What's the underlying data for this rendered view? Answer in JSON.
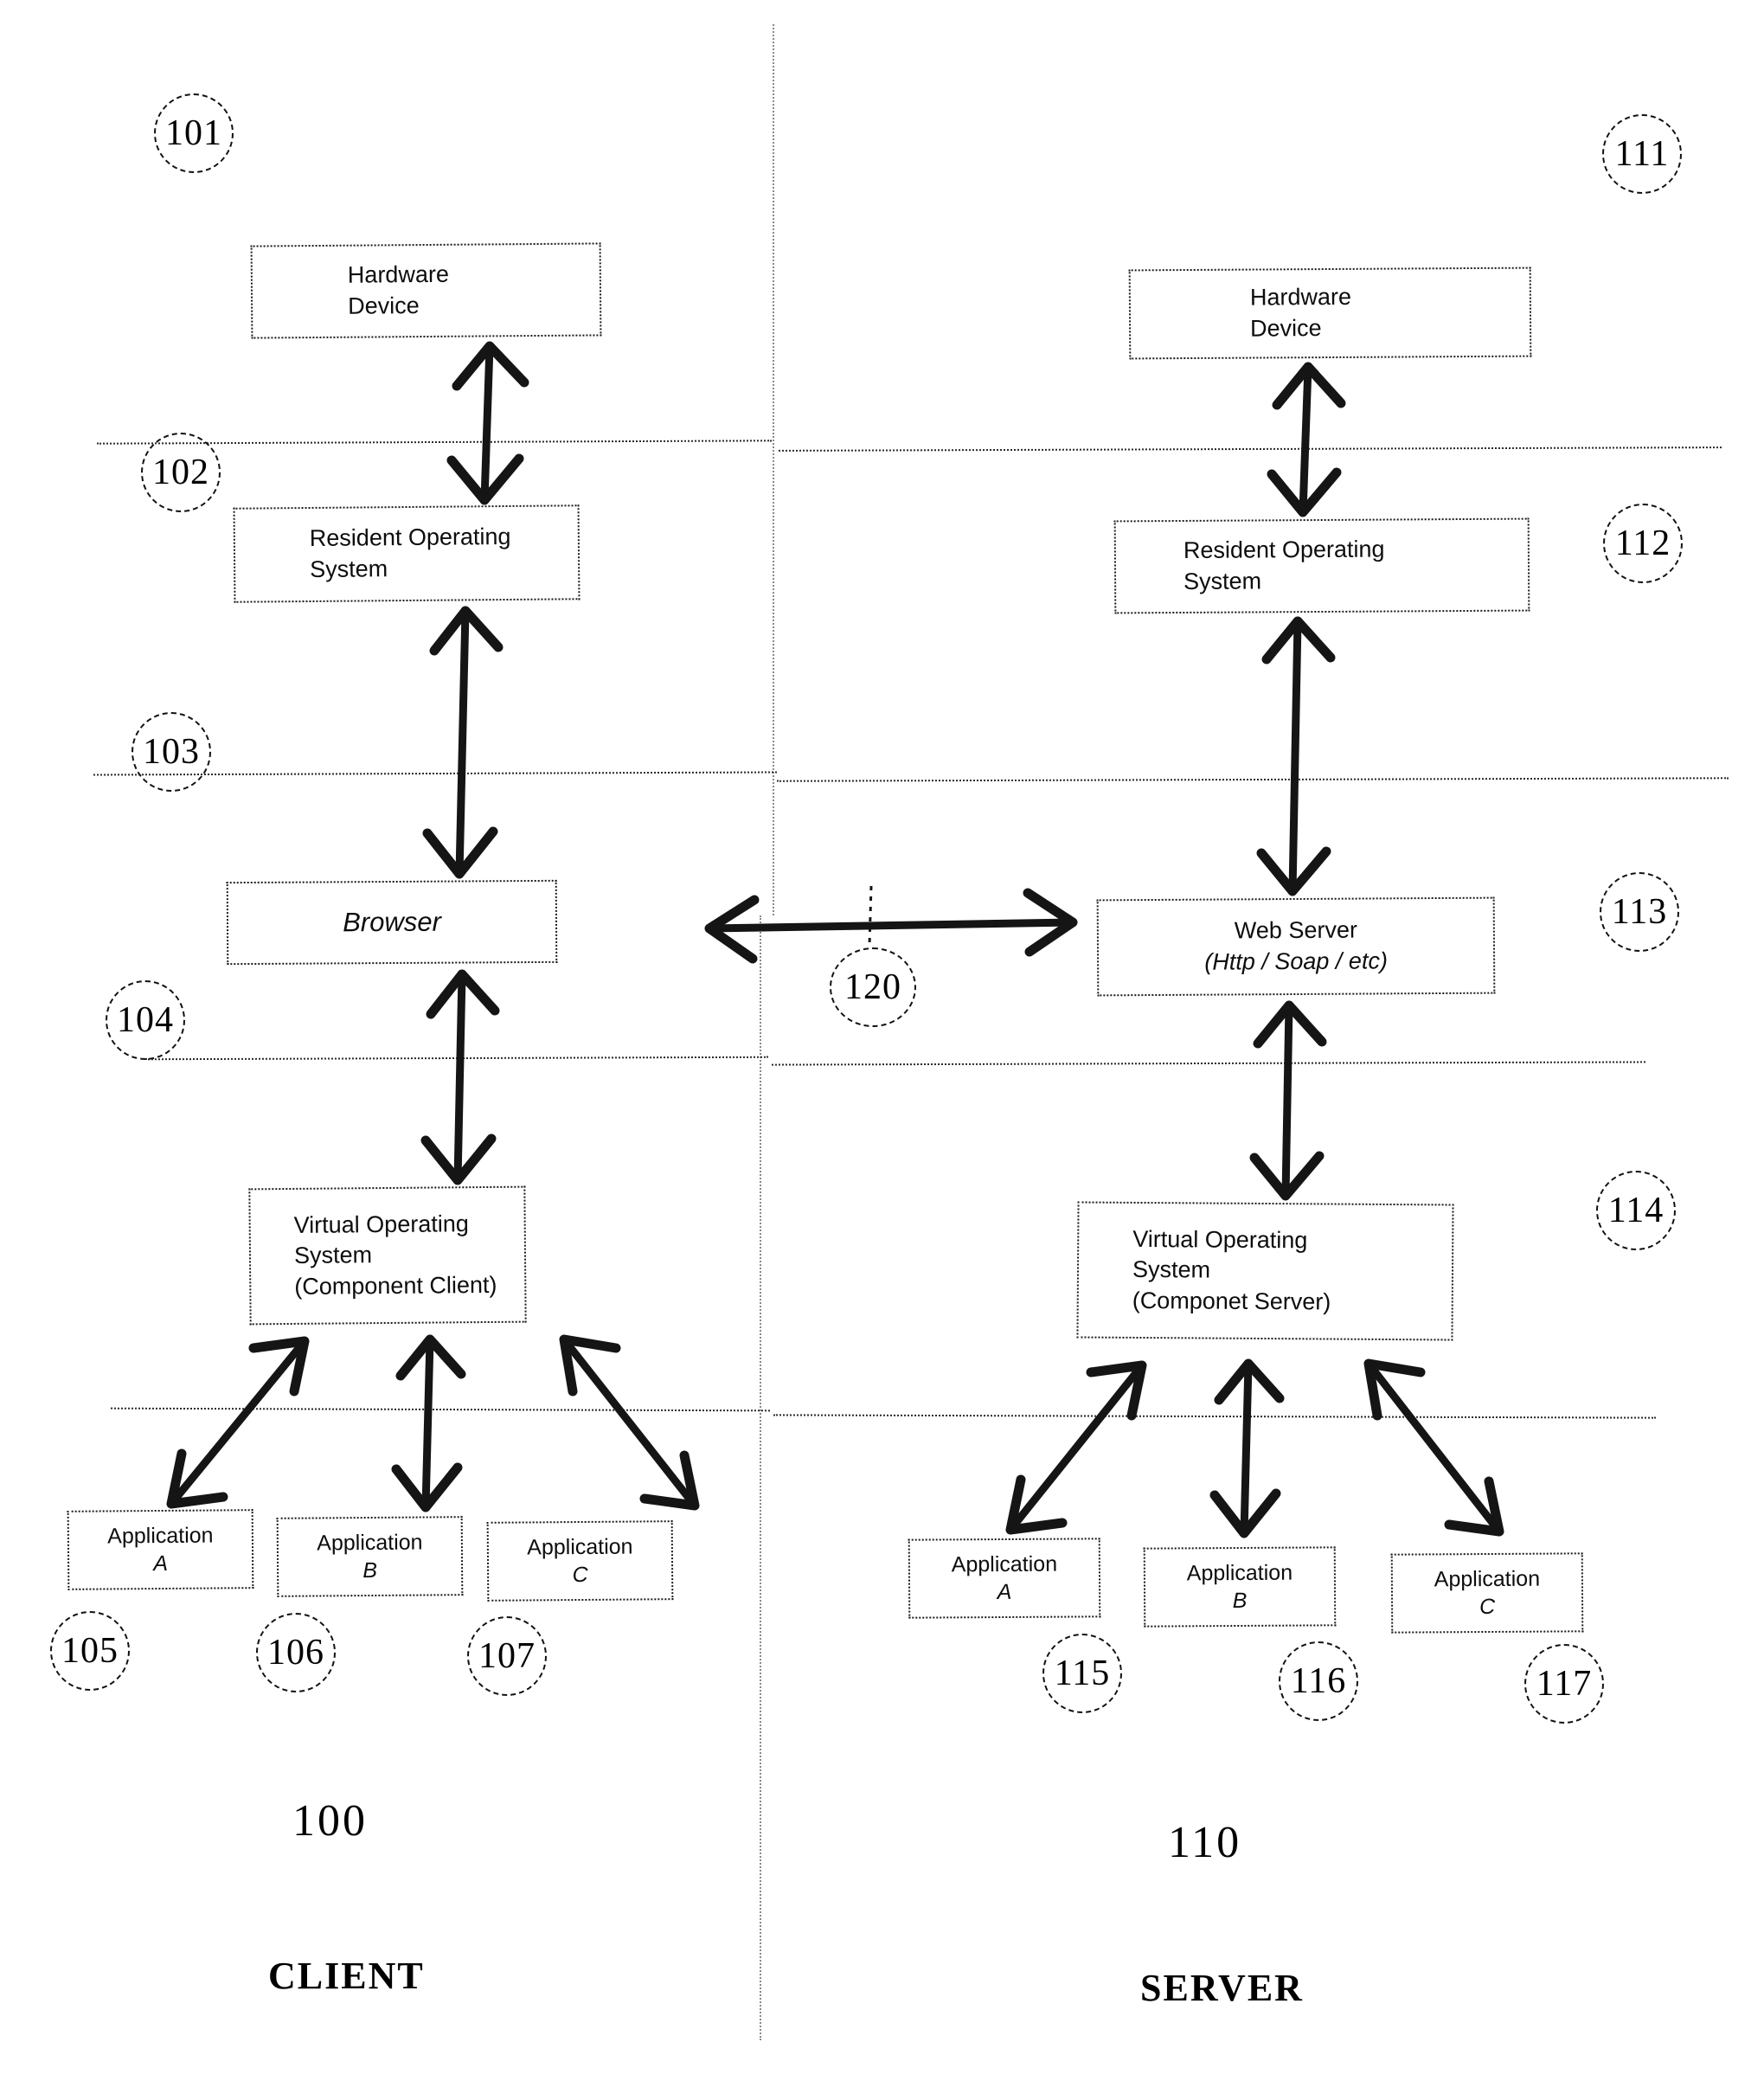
{
  "figure": {
    "type": "patent-architecture-diagram",
    "background_color": "#ffffff",
    "ink_color": "#111111"
  },
  "client": {
    "system_number": "100",
    "system_label": "CLIENT",
    "nodes": {
      "hardware_device": {
        "line1": "Hardware",
        "line2": "Device",
        "ref": "101"
      },
      "resident_os": {
        "line1": "Resident Operating",
        "line2": "System",
        "ref": "102"
      },
      "browser": {
        "line1": "Browser",
        "ref": "103"
      },
      "virtual_os": {
        "line1": "Virtual Operating",
        "line2": "System",
        "line3": "(Component Client)",
        "ref": "104"
      },
      "application_a": {
        "line1": "Application",
        "line2": "A",
        "ref": "105"
      },
      "application_b": {
        "line1": "Application",
        "line2": "B",
        "ref": "106"
      },
      "application_c": {
        "line1": "Application",
        "line2": "C",
        "ref": "107"
      }
    }
  },
  "server": {
    "system_number": "110",
    "system_label": "SERVER",
    "nodes": {
      "hardware_device": {
        "line1": "Hardware",
        "line2": "Device",
        "ref": "111"
      },
      "resident_os": {
        "line1": "Resident Operating",
        "line2": "System",
        "ref": "112"
      },
      "web_server": {
        "line1": "Web Server",
        "line2": "(Http / Soap / etc)",
        "ref": "113"
      },
      "virtual_os": {
        "line1": "Virtual Operating",
        "line2": "System",
        "line3": "(Componet Server)",
        "ref": "114"
      },
      "application_a": {
        "line1": "Application",
        "line2": "A",
        "ref": "115"
      },
      "application_b": {
        "line1": "Application",
        "line2": "B",
        "ref": "116"
      },
      "application_c": {
        "line1": "Application",
        "line2": "C",
        "ref": "117"
      }
    }
  },
  "link": {
    "ref": "120",
    "description": "browser to web server bidirectional link"
  }
}
